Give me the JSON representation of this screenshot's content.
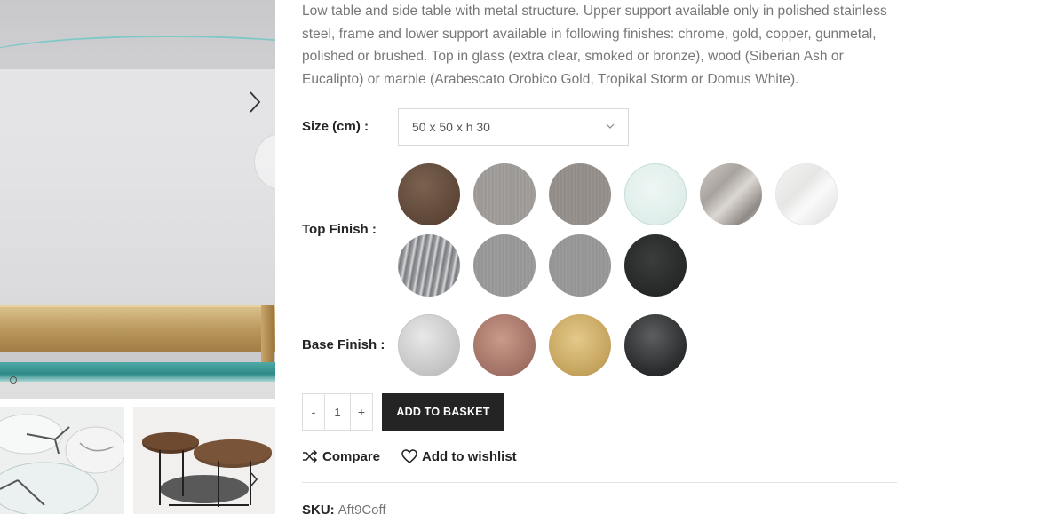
{
  "product": {
    "description": "Low table and side table with metal structure. Upper support available only in polished stainless steel, frame and lower support available in following finishes: chrome, gold, copper, gunmetal, polished or brushed. Top in glass (extra clear, smoked or bronze), wood (Siberian Ash or Eucalipto) or marble (Arabescato Orobico Gold, Tropikal Storm or Domus White).",
    "sku_label": "SKU:",
    "sku_value": "Aft9Coff"
  },
  "options": {
    "size_label": "Size (cm) :",
    "size_selected": "50 x 50 x h 30",
    "top_finish_label": "Top Finish :",
    "base_finish_label": "Base Finish :",
    "top_finish_swatches": [
      "walnut-wood",
      "grey-wood-light",
      "grey-wood",
      "extra-clear-glass",
      "arabescato-marble",
      "domus-white-marble",
      "tropikal-storm-marble",
      "grey-brushed",
      "grey-smoked",
      "black"
    ],
    "base_finish_swatches": [
      "chrome",
      "copper",
      "gold",
      "gunmetal"
    ]
  },
  "cart": {
    "minus": "-",
    "quantity": "1",
    "plus": "+",
    "add_to_basket": "ADD TO BASKET"
  },
  "actions": {
    "compare": "Compare",
    "wishlist": "Add to wishlist"
  },
  "colors": {
    "button_bg": "#242424",
    "text_muted": "#777777",
    "divider": "#e3e3e3"
  }
}
